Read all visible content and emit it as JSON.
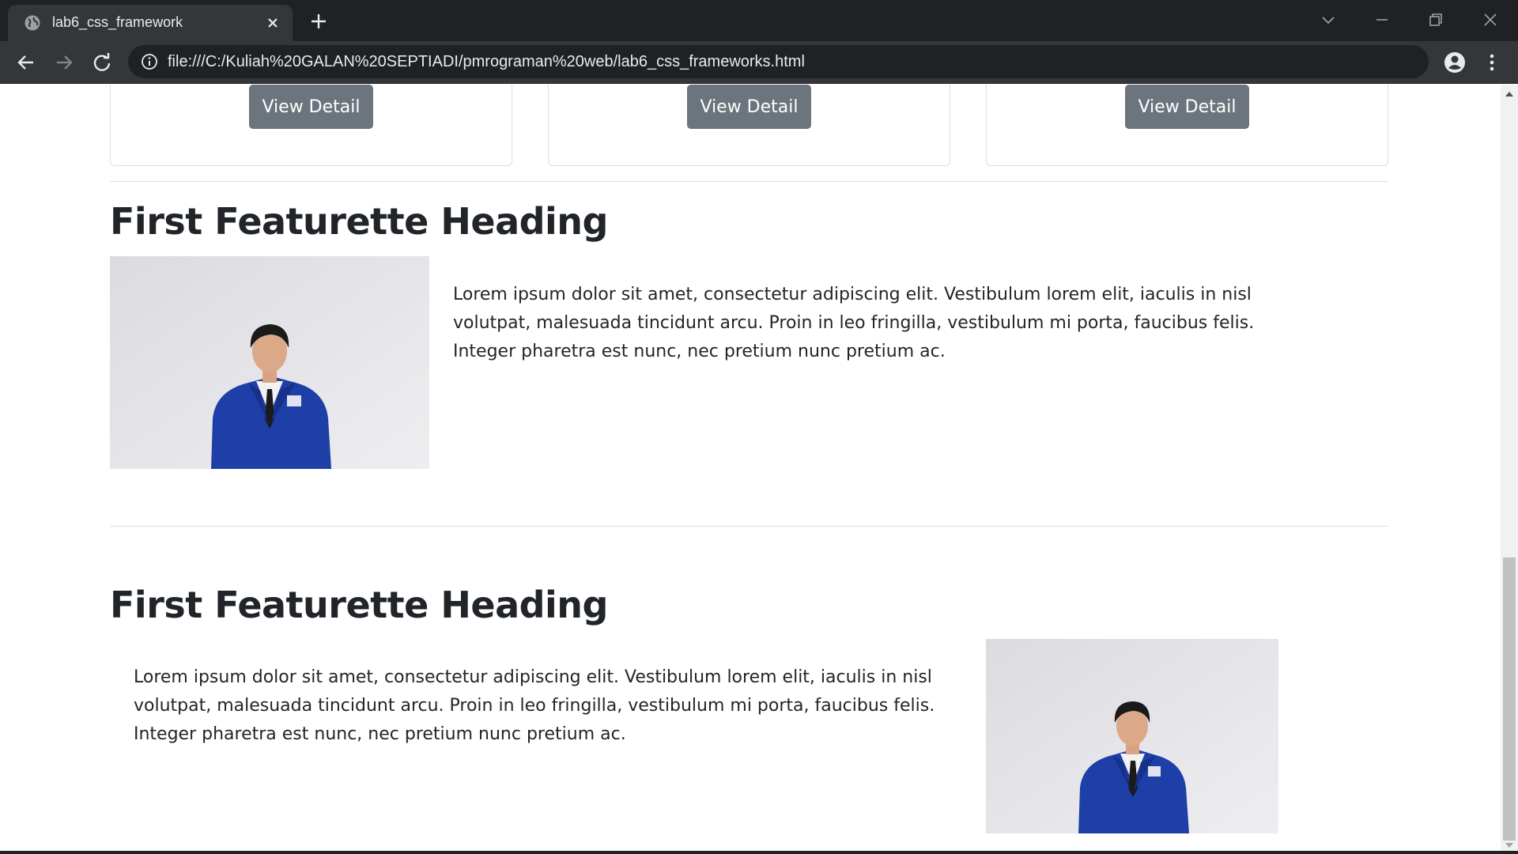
{
  "browser": {
    "tab_title": "lab6_css_framework",
    "address_url": "file:///C:/Kuliah%20GALAN%20SEPTIADI/pmrograman%20web/lab6_css_frameworks.html",
    "icons": [
      "globe-icon",
      "close-icon",
      "plus-icon",
      "tab-search-icon",
      "minimize-icon",
      "restore-icon",
      "window-close-icon",
      "back-icon",
      "forward-icon",
      "reload-icon",
      "info-icon",
      "profile-icon",
      "menu-icon"
    ],
    "colors": {
      "tabstrip": "#202124",
      "toolbar": "#35363a",
      "omnibox": "#202124",
      "text": "#e8eaed"
    }
  },
  "cards": [
    {
      "button_label": "View Detail"
    },
    {
      "button_label": "View Detail"
    },
    {
      "button_label": "View Detail"
    }
  ],
  "featurettes": [
    {
      "heading": "First Featurette Heading",
      "lines": [
        "Lorem ipsum dolor sit amet, consectetur adipiscing elit. Vestibulum lorem elit, iaculis in nisl",
        "volutpat, malesuada tincidunt arcu. Proin in leo fringilla, vestibulum mi porta, faucibus felis.",
        "Integer pharetra est nunc, nec pretium nunc pretium ac."
      ]
    },
    {
      "heading": "First Featurette Heading",
      "lines": [
        "Lorem ipsum dolor sit amet, consectetur adipiscing elit. Vestibulum lorem elit, iaculis in nisl",
        "volutpat, malesuada tincidunt arcu. Proin in leo fringilla, vestibulum mi porta, faucibus felis.",
        "Integer pharetra est nunc, nec pretium nunc pretium ac."
      ]
    }
  ],
  "colors": {
    "button": "#6c757d",
    "heading": "#212529",
    "divider": "#dcdee1",
    "jacket": "#1f3fa8"
  }
}
